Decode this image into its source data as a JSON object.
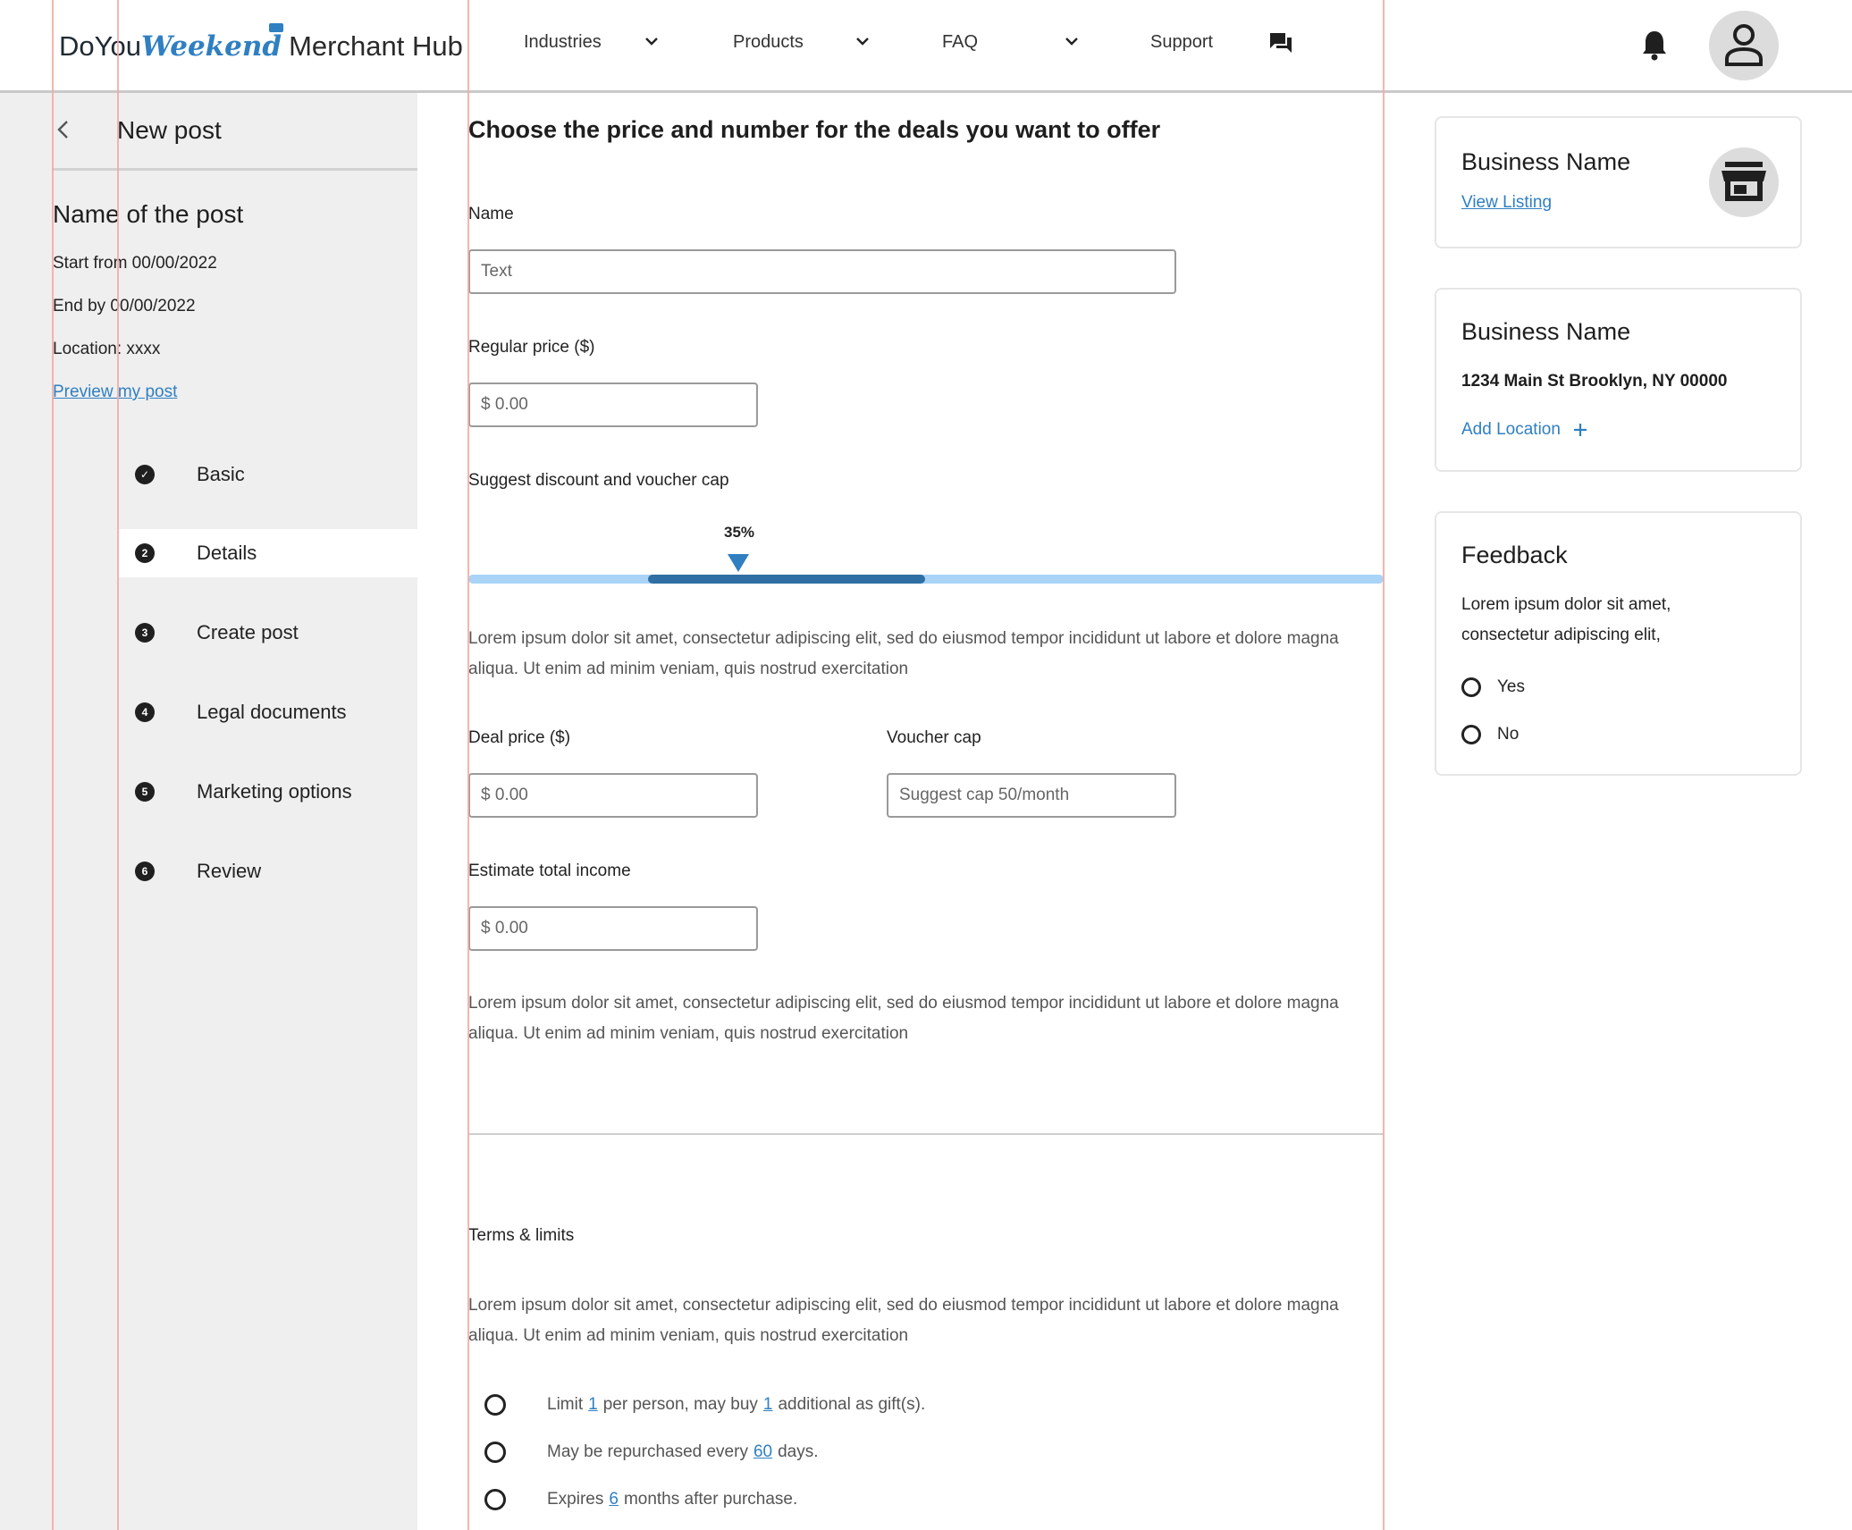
{
  "header": {
    "logo": {
      "part1": "DoYou",
      "part2": "Weekend",
      "part3": "Merchant Hub"
    },
    "nav": [
      {
        "label": "Industries"
      },
      {
        "label": "Products"
      },
      {
        "label": "FAQ"
      },
      {
        "label": "Support"
      }
    ]
  },
  "sidebar": {
    "title": "New post",
    "post_name": "Name of the post",
    "start": "Start from 00/00/2022",
    "end": "End by 00/00/2022",
    "location": "Location: xxxx",
    "preview_link": "Preview my post",
    "steps": [
      {
        "num": "✓",
        "label": "Basic"
      },
      {
        "num": "2",
        "label": "Details"
      },
      {
        "num": "3",
        "label": "Create post"
      },
      {
        "num": "4",
        "label": "Legal documents"
      },
      {
        "num": "5",
        "label": "Marketing options"
      },
      {
        "num": "6",
        "label": "Review"
      }
    ],
    "active_step": "Details"
  },
  "main": {
    "title": "Choose the price and number for the deals you want to offer",
    "name_label": "Name",
    "name_placeholder": "Text",
    "regular_price_label": "Regular price ($)",
    "regular_price_placeholder": "$ 0.00",
    "discount_label": "Suggest discount and voucher cap",
    "discount_value": "35%",
    "paragraph1": "Lorem ipsum dolor sit amet, consectetur adipiscing elit, sed do eiusmod tempor incididunt ut labore et dolore magna aliqua. Ut enim ad minim veniam, quis nostrud exercitation",
    "deal_price_label": "Deal price ($)",
    "deal_price_placeholder": "$ 0.00",
    "voucher_cap_label": "Voucher cap",
    "voucher_cap_placeholder": "Suggest cap 50/month",
    "estimate_label": "Estimate total income",
    "estimate_placeholder": "$ 0.00",
    "paragraph2": "Lorem ipsum dolor sit amet, consectetur adipiscing elit, sed do eiusmod tempor incididunt ut labore et dolore magna aliqua. Ut enim ad minim veniam, quis nostrud exercitation",
    "terms_title": "Terms & limits",
    "paragraph3": "Lorem ipsum dolor sit amet, consectetur adipiscing elit, sed do eiusmod tempor incididunt ut labore et dolore magna aliqua. Ut enim ad minim veniam, quis nostrud exercitation",
    "terms": [
      {
        "a": "Limit",
        "v1": "1",
        "b": "per person, may buy",
        "v2": "1",
        "c": "additional as gift(s)."
      },
      {
        "a": "May be repurchased every",
        "v1": "60",
        "b": "days."
      },
      {
        "a": "Expires",
        "v1": "6",
        "b": "months after purchase."
      }
    ]
  },
  "right": {
    "card1": {
      "title": "Business Name",
      "link": "View Listing"
    },
    "card2": {
      "title": "Business Name",
      "address": "1234 Main St Brooklyn, NY 00000",
      "add_location": "Add Location"
    },
    "card3": {
      "title": "Feedback",
      "text1": "Lorem ipsum dolor sit amet,",
      "text2": "consectetur adipiscing elit,",
      "options": [
        "Yes",
        "No"
      ]
    }
  },
  "colors": {
    "accent": "#2f7fc1",
    "slider_fill": "#2f6fa3",
    "slider_track": "#a9d3f7",
    "sidebar_bg": "#efefef"
  },
  "icons": [
    "chevron-left-icon",
    "chevron-down-icon",
    "chat-icon",
    "bell-icon",
    "user-icon",
    "store-icon",
    "plus-icon",
    "check-icon"
  ]
}
